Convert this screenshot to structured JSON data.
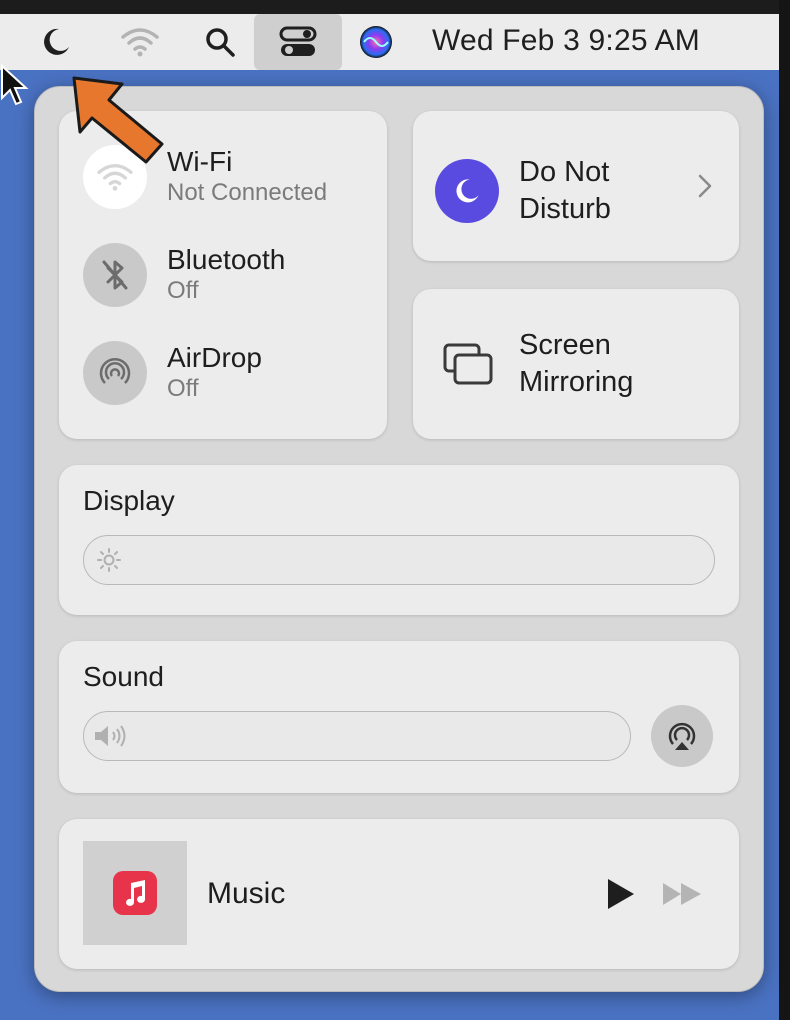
{
  "menubar": {
    "clock": "Wed Feb 3  9:25 AM",
    "icons": [
      "moon-icon",
      "wifi-icon",
      "search-icon",
      "control-center-icon",
      "siri-icon"
    ]
  },
  "wifi": {
    "title": "Wi-Fi",
    "status": "Not Connected"
  },
  "bluetooth": {
    "title": "Bluetooth",
    "status": "Off"
  },
  "airdrop": {
    "title": "AirDrop",
    "status": "Off"
  },
  "dnd": {
    "title_line1": "Do Not",
    "title_line2": "Disturb"
  },
  "mirroring": {
    "title_line1": "Screen",
    "title_line2": "Mirroring"
  },
  "display": {
    "label": "Display",
    "brightness": 0.0
  },
  "sound": {
    "label": "Sound",
    "volume": 0.0
  },
  "music": {
    "label": "Music"
  },
  "colors": {
    "accent_purple": "#5a4be0",
    "pointer_arrow": "#e8772e",
    "music_red": "#e8344a"
  }
}
